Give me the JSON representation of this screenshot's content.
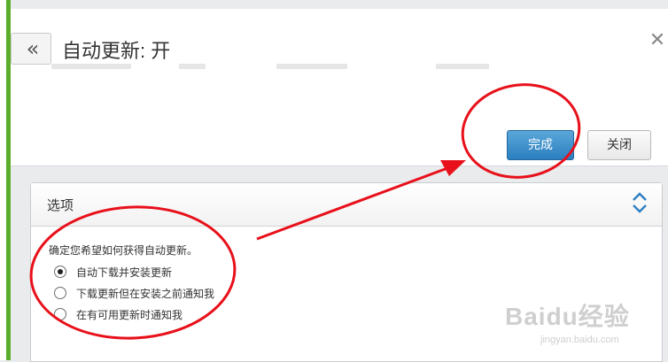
{
  "window": {
    "title": "自动更新: 开",
    "back_glyph": "«",
    "close_glyph": "✕"
  },
  "actions": {
    "done_label": "完成",
    "close_label": "关闭"
  },
  "options": {
    "section_title": "选项",
    "toggle_glyph": "⌃⌄",
    "question": "确定您希望如何获得自动更新。",
    "choices": [
      {
        "label": "自动下载并安装更新",
        "selected": true
      },
      {
        "label": "下载更新但在安装之前通知我",
        "selected": false
      },
      {
        "label": "在有可用更新时通知我",
        "selected": false
      }
    ]
  },
  "watermark": {
    "brand": "Baidu经验",
    "url": "jingyan.baidu.com"
  },
  "colors": {
    "accent_green": "#5cae2a",
    "primary_blue": "#2b7fc0",
    "annotation_red": "#e8101a"
  }
}
